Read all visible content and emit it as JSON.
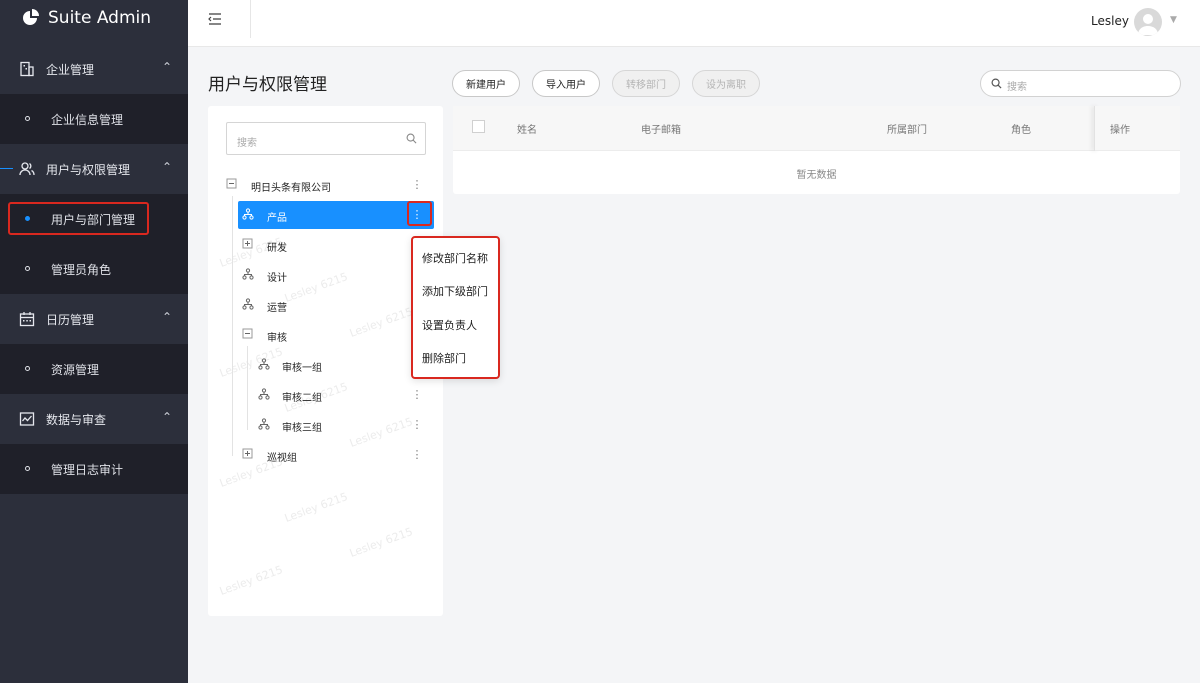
{
  "app": {
    "title": "Suite Admin"
  },
  "sidebar": {
    "groups": [
      {
        "label": "企业管理",
        "icon": "building-icon",
        "children": [
          {
            "label": "企业信息管理"
          }
        ]
      },
      {
        "label": "用户与权限管理",
        "icon": "users-icon",
        "children": [
          {
            "label": "用户与部门管理",
            "active": true
          },
          {
            "label": "管理员角色"
          }
        ]
      },
      {
        "label": "日历管理",
        "icon": "calendar-icon",
        "children": [
          {
            "label": "资源管理"
          }
        ]
      },
      {
        "label": "数据与审查",
        "icon": "chart-monitor-icon",
        "children": [
          {
            "label": "管理日志审计"
          }
        ]
      }
    ]
  },
  "header": {
    "user": "Lesley"
  },
  "page": {
    "title": "用户与权限管理",
    "actions": {
      "new_user": "新建用户",
      "import_user": "导入用户",
      "transfer_dept": "转移部门",
      "set_leave": "设为离职"
    },
    "search_placeholder": "搜索"
  },
  "tree": {
    "search_placeholder": "搜索",
    "root": "明日头条有限公司",
    "nodes": [
      "产品",
      "研发",
      "设计",
      "运营",
      "审核",
      "审核一组",
      "审核二组",
      "审核三组",
      "巡视组"
    ],
    "watermark": "Lesley 6215"
  },
  "context_menu": {
    "items": [
      "修改部门名称",
      "添加下级部门",
      "设置负责人",
      "删除部门"
    ]
  },
  "table": {
    "columns": [
      "姓名",
      "电子邮箱",
      "所属部门",
      "角色",
      "操作"
    ],
    "empty_text": "暂无数据"
  },
  "colors": {
    "sidebar_bg": "#2c2f3b",
    "submenu_bg": "#1f2029",
    "primary": "#1890ff",
    "highlight": "#d9281f"
  }
}
